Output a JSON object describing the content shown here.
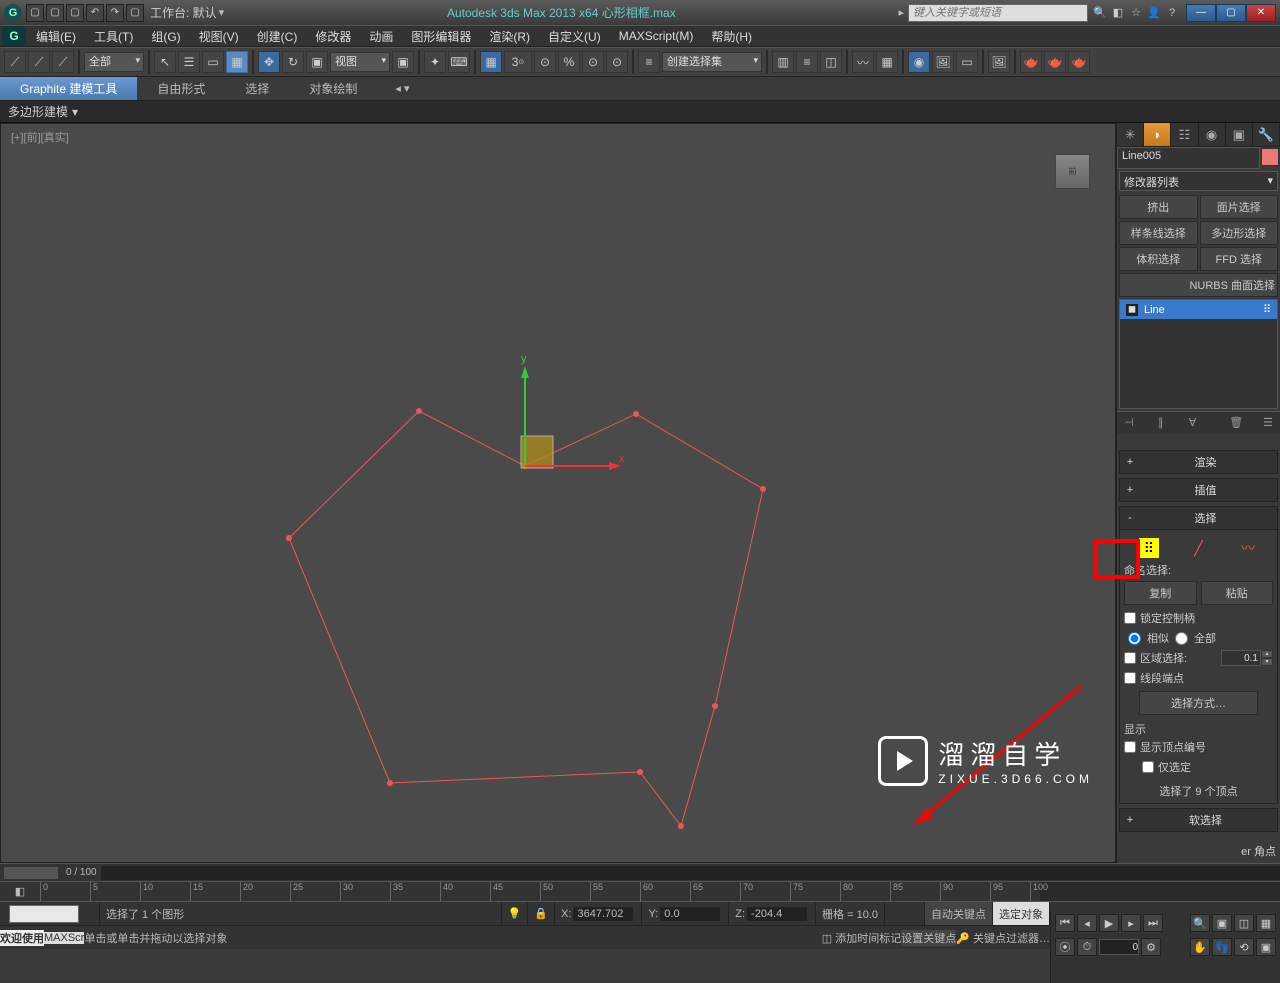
{
  "titlebar": {
    "workspace_label": "工作台: 默认",
    "title": "Autodesk 3ds Max  2013 x64    心形相框.max",
    "search_placeholder": "键入关键字或短语"
  },
  "menu": {
    "items": [
      "编辑(E)",
      "工具(T)",
      "组(G)",
      "视图(V)",
      "创建(C)",
      "修改器",
      "动画",
      "图形编辑器",
      "渲染(R)",
      "自定义(U)",
      "MAXScript(M)",
      "帮助(H)"
    ]
  },
  "toolbar": {
    "filter_all": "全部",
    "view_label": "视图",
    "selection_set": "创建选择集"
  },
  "ribbon": {
    "tabs": [
      "Graphite 建模工具",
      "自由形式",
      "选择",
      "对象绘制"
    ],
    "panel_label": "多边形建模"
  },
  "viewport": {
    "label": "[+][前][真实]"
  },
  "cmd": {
    "object_name": "Line005",
    "modifier_list": "修改器列表",
    "buttons": [
      "挤出",
      "面片选择",
      "样条线选择",
      "多边形选择",
      "体积选择",
      "FFD 选择"
    ],
    "nurbs": "NURBS 曲面选择",
    "stack_item": "Line",
    "rollouts": {
      "render": "渲染",
      "interp": "插值",
      "selection": "选择",
      "soft": "软选择"
    },
    "sel": {
      "named_label": "命名选择:",
      "copy": "复制",
      "paste": "粘贴",
      "lock_handles": "锁定控制柄",
      "similar": "相似",
      "all": "全部",
      "area_select": "区域选择:",
      "area_value": "0.1",
      "seg_end": "线段端点",
      "select_by": "选择方式…",
      "display": "显示",
      "show_vertex_num": "显示顶点编号",
      "only_selected": "仅选定",
      "selected_count": "选择了 9 个顶点"
    }
  },
  "timeline": {
    "range": "0 / 100",
    "ticks": [
      "0",
      "5",
      "10",
      "15",
      "20",
      "25",
      "30",
      "35",
      "40",
      "45",
      "50",
      "55",
      "60",
      "65",
      "70",
      "75",
      "80",
      "85",
      "90",
      "95",
      "100"
    ]
  },
  "status": {
    "welcome": "欢迎使用",
    "maxscr": "MAXScr",
    "selected": "选择了 1 个图形",
    "x": "3647.702",
    "y": "0.0",
    "z": "-204.4",
    "grid": "栅格 = 10.0",
    "hint": "单击或单击并拖动以选择对象",
    "add_marker": "添加时间标记",
    "auto_key": "自动关键点",
    "set_key": "设置关键点",
    "selected_obj": "选定对象",
    "key_filter": "关键点过滤器…",
    "corner": "er 角点"
  },
  "watermark": {
    "cn": "溜溜自学",
    "en": "ZIXUE.3D66.COM"
  }
}
